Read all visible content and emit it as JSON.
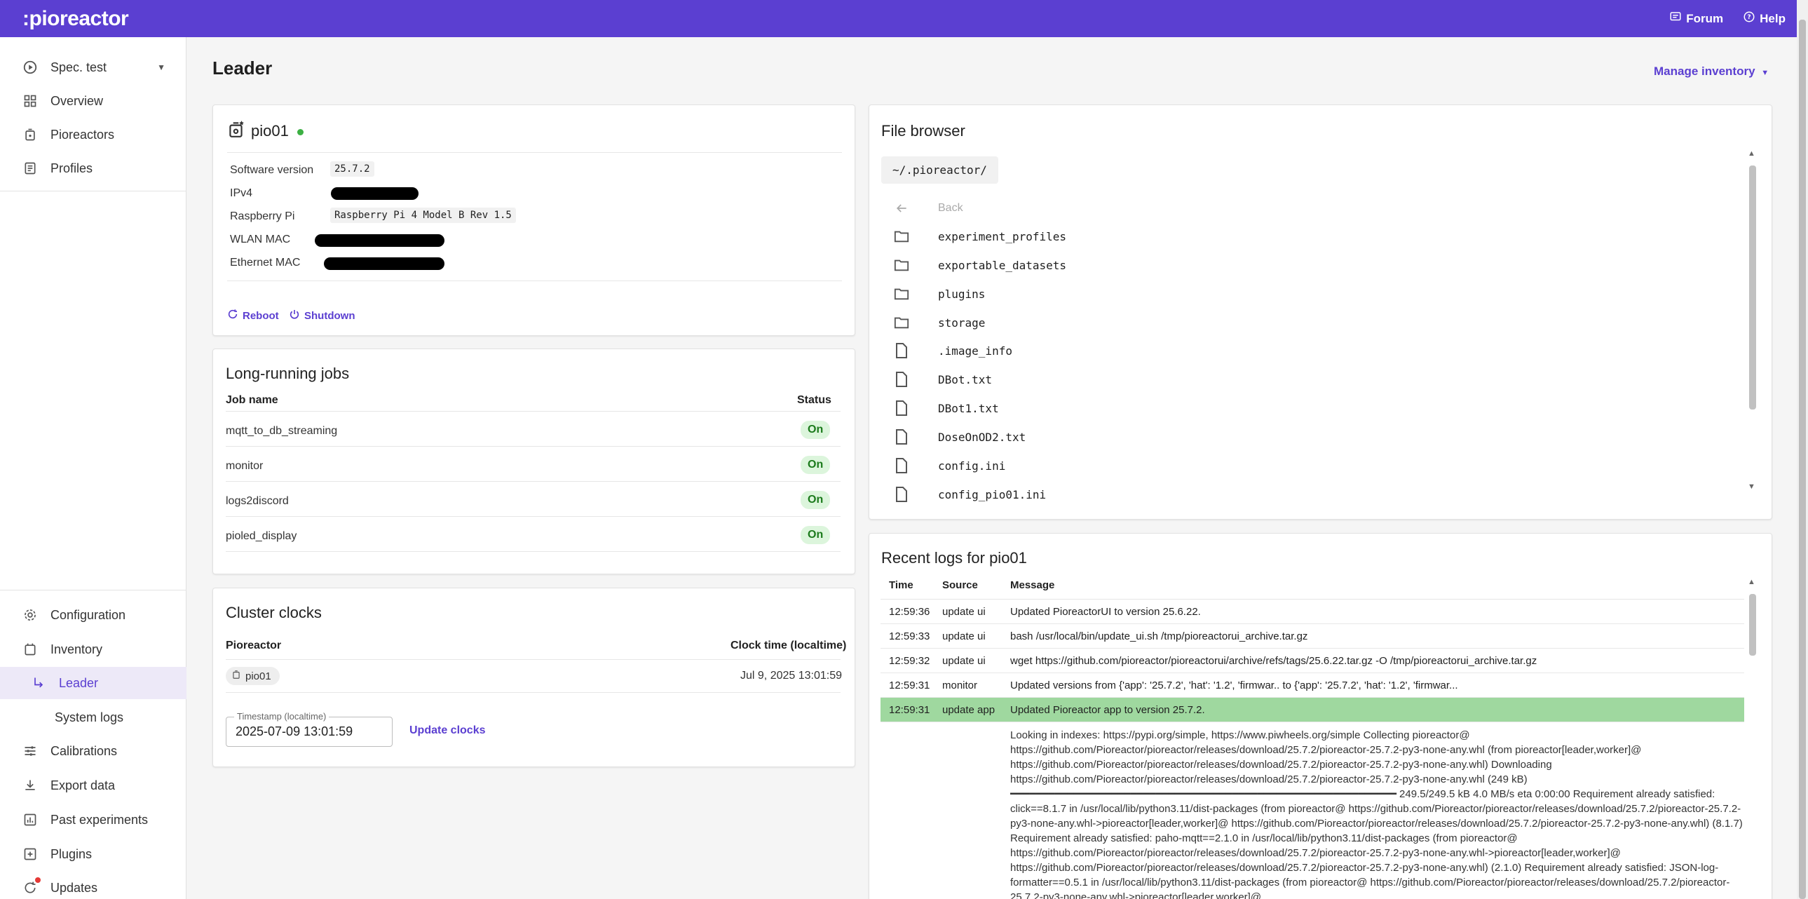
{
  "topbar": {
    "logo": ":pioreactor",
    "forum": "Forum",
    "help": "Help"
  },
  "sidebar": {
    "experiment": "Spec. test",
    "top_items": [
      "Overview",
      "Pioreactors",
      "Profiles"
    ],
    "bottom_items": [
      "Configuration",
      "Inventory"
    ],
    "inventory_sub": [
      "Leader",
      "System logs"
    ],
    "more_items": [
      "Calibrations",
      "Export data",
      "Past experiments",
      "Plugins",
      "Updates"
    ]
  },
  "page": {
    "title": "Leader",
    "manage_inventory": "Manage inventory"
  },
  "leader_card": {
    "name": "pio01",
    "rows": [
      {
        "label": "Software version",
        "value": "25.7.2"
      },
      {
        "label": "IPv4",
        "value": ""
      },
      {
        "label": "Raspberry Pi",
        "value": "Raspberry Pi 4 Model B Rev 1.5"
      },
      {
        "label": "WLAN MAC",
        "value": ""
      },
      {
        "label": "Ethernet MAC",
        "value": ""
      }
    ],
    "reboot": "Reboot",
    "shutdown": "Shutdown"
  },
  "jobs_card": {
    "title": "Long-running jobs",
    "col_job": "Job name",
    "col_status": "Status",
    "jobs": [
      {
        "name": "mqtt_to_db_streaming",
        "status": "On"
      },
      {
        "name": "monitor",
        "status": "On"
      },
      {
        "name": "logs2discord",
        "status": "On"
      },
      {
        "name": "pioled_display",
        "status": "On"
      }
    ]
  },
  "clocks_card": {
    "title": "Cluster clocks",
    "col_pioreactor": "Pioreactor",
    "col_clock": "Clock time (localtime)",
    "unit": "pio01",
    "clock": "Jul 9, 2025 13:01:59",
    "timestamp_label": "Timestamp (localtime)",
    "timestamp_value": "2025-07-09 13:01:59",
    "update_button": "Update clocks"
  },
  "file_browser": {
    "title": "File browser",
    "path": "~/.pioreactor/",
    "back": "Back",
    "entries": [
      {
        "name": "experiment_profiles",
        "type": "folder"
      },
      {
        "name": "exportable_datasets",
        "type": "folder"
      },
      {
        "name": "plugins",
        "type": "folder"
      },
      {
        "name": "storage",
        "type": "folder"
      },
      {
        "name": ".image_info",
        "type": "file"
      },
      {
        "name": "DBot.txt",
        "type": "file"
      },
      {
        "name": "DBot1.txt",
        "type": "file"
      },
      {
        "name": "DoseOnOD2.txt",
        "type": "file"
      },
      {
        "name": "config.ini",
        "type": "file"
      },
      {
        "name": "config_pio01.ini",
        "type": "file"
      }
    ]
  },
  "logs": {
    "title": "Recent logs for pio01",
    "col_time": "Time",
    "col_source": "Source",
    "col_message": "Message",
    "rows": [
      {
        "time": "12:59:36",
        "source": "update ui",
        "message": "Updated PioreactorUI to version 25.6.22."
      },
      {
        "time": "12:59:33",
        "source": "update ui",
        "message": "bash /usr/local/bin/update_ui.sh /tmp/pioreactorui_archive.tar.gz"
      },
      {
        "time": "12:59:32",
        "source": "update ui",
        "message": "wget https://github.com/pioreactor/pioreactorui/archive/refs/tags/25.6.22.tar.gz -O /tmp/pioreactorui_archive.tar.gz"
      },
      {
        "time": "12:59:31",
        "source": "monitor",
        "message": "Updated versions from {'app': '25.7.2', 'hat': '1.2', 'firmwar.. to {'app': '25.7.2', 'hat': '1.2', 'firmwar..."
      },
      {
        "time": "12:59:31",
        "source": "update app",
        "message": "Updated Pioreactor app to version 25.7.2."
      }
    ],
    "long_message": "Looking in indexes: https://pypi.org/simple, https://www.piwheels.org/simple Collecting pioreactor@ https://github.com/Pioreactor/pioreactor/releases/download/25.7.2/pioreactor-25.7.2-py3-none-any.whl (from pioreactor[leader,worker]@ https://github.com/Pioreactor/pioreactor/releases/download/25.7.2/pioreactor-25.7.2-py3-none-any.whl) Downloading https://github.com/Pioreactor/pioreactor/releases/download/25.7.2/pioreactor-25.7.2-py3-none-any.whl (249 kB) ━━━━━━━━━━━━━━━━━━━━━━━━━━━━━━━━━━━━━━━━━━━━━━━━━━━━━━━━━━━━━ 249.5/249.5 kB 4.0 MB/s eta 0:00:00 Requirement already satisfied: click==8.1.7 in /usr/local/lib/python3.11/dist-packages (from pioreactor@ https://github.com/Pioreactor/pioreactor/releases/download/25.7.2/pioreactor-25.7.2-py3-none-any.whl->pioreactor[leader,worker]@ https://github.com/Pioreactor/pioreactor/releases/download/25.7.2/pioreactor-25.7.2-py3-none-any.whl) (8.1.7) Requirement already satisfied: paho-mqtt==2.1.0 in /usr/local/lib/python3.11/dist-packages (from pioreactor@ https://github.com/Pioreactor/pioreactor/releases/download/25.7.2/pioreactor-25.7.2-py3-none-any.whl->pioreactor[leader,worker]@ https://github.com/Pioreactor/pioreactor/releases/download/25.7.2/pioreactor-25.7.2-py3-none-any.whl) (2.1.0) Requirement already satisfied: JSON-log-formatter==0.5.1 in /usr/local/lib/python3.11/dist-packages (from pioreactor@ https://github.com/Pioreactor/pioreactor/releases/download/25.7.2/pioreactor-25.7.2-py3-none-any.whl->pioreactor[leader,worker]@"
  }
}
